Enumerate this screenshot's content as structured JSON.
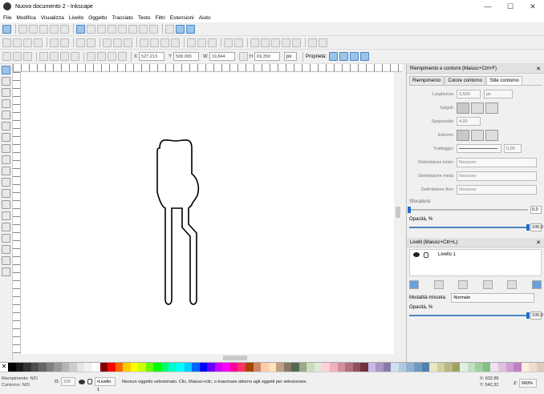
{
  "window": {
    "title": "Nuovo documento 2 - Inkscape",
    "min": "—",
    "max": "☐",
    "close": "✕"
  },
  "menu": [
    "File",
    "Modifica",
    "Visualizza",
    "Livello",
    "Oggetto",
    "Tracciato",
    "Testo",
    "Filtri",
    "Estensioni",
    "Aiuto"
  ],
  "coords": {
    "x_label": "X",
    "x": "527,213",
    "y_label": "Y",
    "y": "508,065",
    "w_label": "W",
    "w": "19,844",
    "h_label": "H",
    "h": "69,359",
    "unit": "px",
    "props_label": "Proprietà:"
  },
  "panel": {
    "title": "Riempimento e contorni (Maiusc+Ctrl+F)",
    "close": "✕",
    "tabs": [
      "Riempimento",
      "Colore contorno",
      "Stile contorno"
    ],
    "width_label": "Larghezza:",
    "width_value": "0,500",
    "width_unit": "px",
    "joins_label": "Spigoli:",
    "miter_label": "Spigolosità:",
    "miter_value": "4,00",
    "caps_label": "Estremi:",
    "dashes_label": "Tratteggio:",
    "dashes_value": "0,00",
    "marker_start_label": "Delimitatore inizio:",
    "marker_start": "Nessuno",
    "marker_mid_label": "Delimitatore metà:",
    "marker_mid": "Nessuno",
    "marker_end_label": "Delimitatore fine:",
    "marker_end": "Nessuno",
    "blur_label": "Sfocatura:",
    "blur_value": "0,0",
    "blur_pct": 0,
    "opacity_label": "Opacità, %",
    "opacity_value": "100,0",
    "opacity_pct": 100
  },
  "layers": {
    "title": "Livelli (Maiusc+Ctrl+L)",
    "close": "✕",
    "layer_name": "Livello 1",
    "blend_label": "Modalità miscela:",
    "blend_value": "Normale",
    "opacity_label": "Opacità, %",
    "opacity_value": "100,0",
    "opacity_pct": 100
  },
  "status": {
    "fill_label": "Riempimento:",
    "fill_value": "N/D",
    "stroke_label": "Contorno:",
    "stroke_value": "N/D",
    "opacity_label": "O:",
    "opacity_value": "100",
    "layer": "•Livello 1",
    "message": "Nessun oggetto selezionato. Clic, Maiusc+clic, o trascinare attorno agli oggetti per selezionare.",
    "x_label": "X:",
    "x": "632,86",
    "y_label": "Y:",
    "y": "542,32",
    "zoom_label": "Z:",
    "zoom": "560%"
  },
  "colors": {
    "accent": "#4a86c5",
    "palette": [
      "#000000",
      "#1a1a1a",
      "#333333",
      "#4d4d4d",
      "#666666",
      "#808080",
      "#999999",
      "#b3b3b3",
      "#cccccc",
      "#e6e6e6",
      "#f2f2f2",
      "#ffffff",
      "#800000",
      "#ff0000",
      "#ff6600",
      "#ffcc00",
      "#ffff00",
      "#ccff00",
      "#66ff00",
      "#00ff00",
      "#00ff66",
      "#00ffcc",
      "#00ffff",
      "#00ccff",
      "#0066ff",
      "#0000ff",
      "#6600ff",
      "#cc00ff",
      "#ff00ff",
      "#ff0099",
      "#ff3366",
      "#aa4400",
      "#cc8866",
      "#ffccaa",
      "#ffe0c0",
      "#c0a080",
      "#887766",
      "#556655",
      "#99aa88",
      "#ccddbb",
      "#e0e8d8",
      "#ffd0d8",
      "#f0b0c0",
      "#d090a0",
      "#b07080",
      "#905060",
      "#703040",
      "#c8b8e8",
      "#a898c8",
      "#887aa8",
      "#d0e0f0",
      "#b0c8e0",
      "#90b0d0",
      "#7098c0",
      "#5080b0",
      "#e8e8c0",
      "#d0d0a0",
      "#b8b880",
      "#a0a060",
      "#e0f0e0",
      "#c0e0c0",
      "#a0d0a0",
      "#80c080",
      "#f0e0f0",
      "#e0c0e0",
      "#d0a0d0",
      "#c080c0",
      "#ffeedd",
      "#eeddcc",
      "#ddccbb"
    ]
  }
}
